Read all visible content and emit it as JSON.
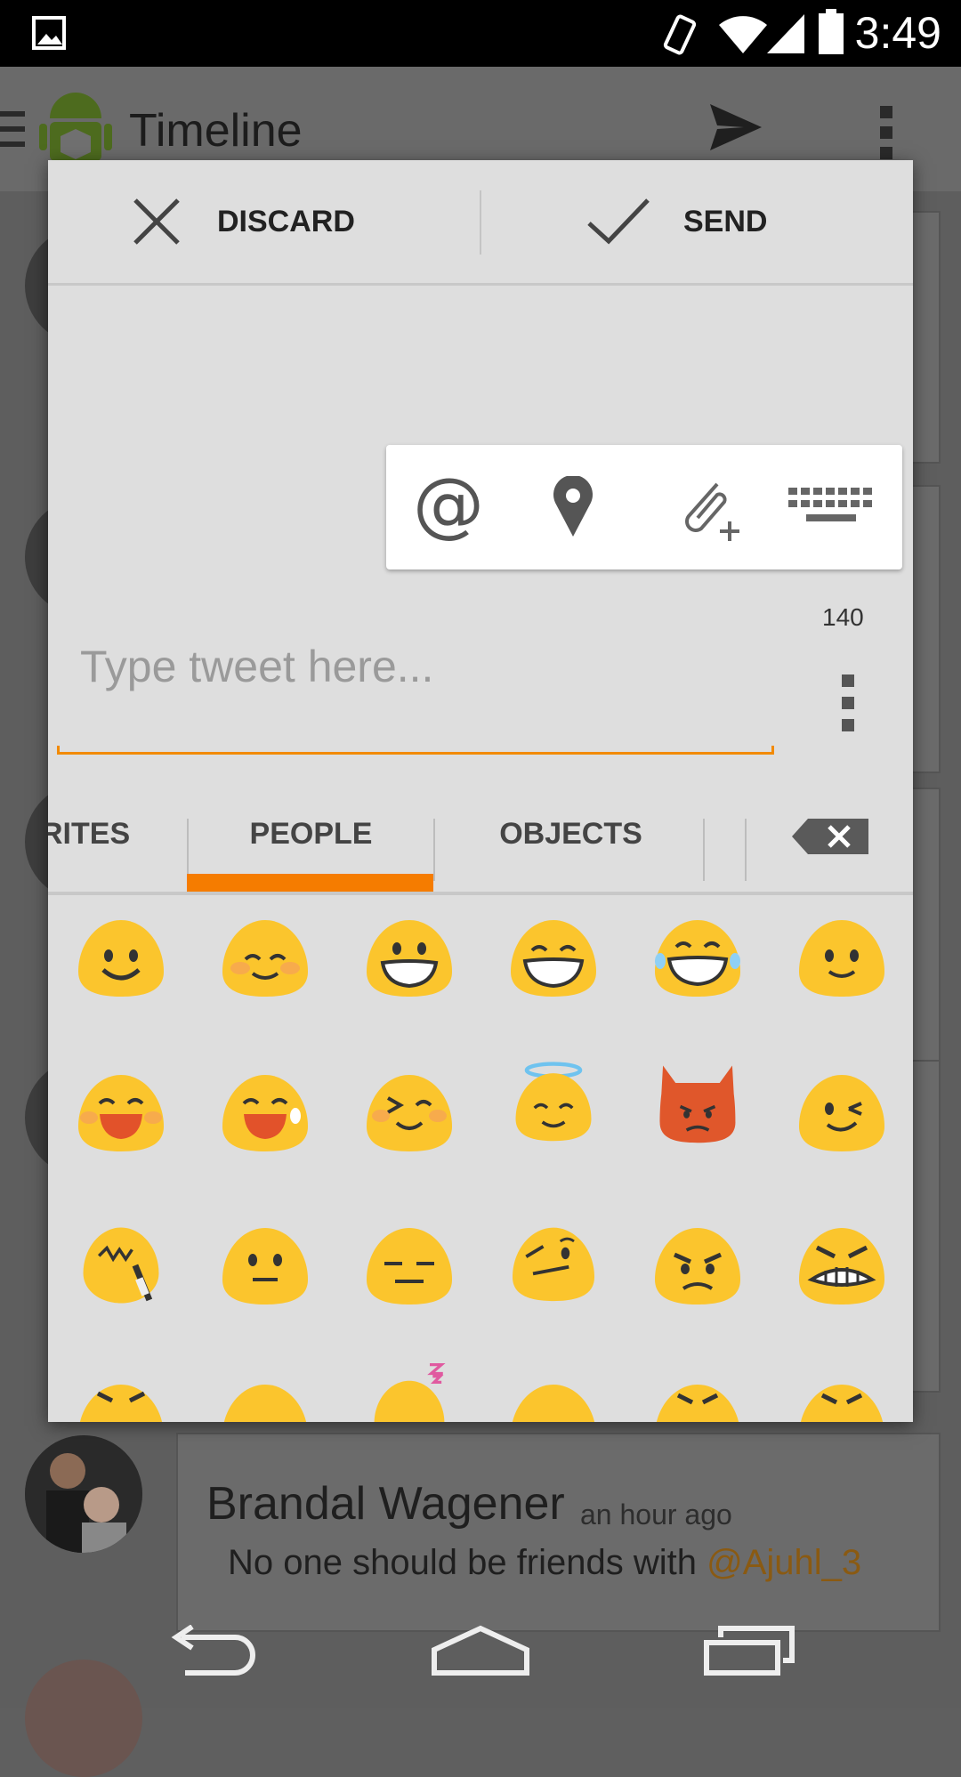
{
  "status_bar": {
    "time": "3:49",
    "icons": [
      "image-icon",
      "rotation-icon",
      "wifi-icon",
      "signal-icon",
      "battery-icon"
    ]
  },
  "app_bar": {
    "title": "Timeline",
    "icons": [
      "menu-icon",
      "android-logo-icon",
      "send-icon",
      "overflow-menu-icon"
    ]
  },
  "dialog": {
    "discard_label": "DISCARD",
    "send_label": "SEND",
    "toolbar_icons": [
      "at-mention-icon",
      "location-pin-icon",
      "attach-icon",
      "keyboard-icon"
    ],
    "char_count": "140",
    "input_placeholder": "Type tweet here...",
    "accent_color": "#f57c00"
  },
  "emoji_tabs": {
    "tabs": [
      "RITES",
      "PEOPLE",
      "OBJECTS"
    ],
    "active": "PEOPLE",
    "backspace_icon": "backspace-icon"
  },
  "emoji_grid": {
    "rows": [
      [
        "smiling-face",
        "smiling-blushing-face",
        "grinning-face",
        "grinning-smiling-eyes-face",
        "tears-of-joy-face",
        "slight-smile-face"
      ],
      [
        "laughing-face",
        "sweat-smile-face",
        "squinting-blush-face",
        "halo-face",
        "devil-face",
        "winking-face"
      ],
      [
        "zipper-mouth-face",
        "neutral-face",
        "expressionless-face",
        "confused-face",
        "angry-face",
        "grimacing-face"
      ]
    ]
  },
  "timeline": {
    "tweet": {
      "name": "Brandal Wagener",
      "time": "an hour ago",
      "body": "No one should be friends with ",
      "mention": "@Ajuhl_3"
    }
  }
}
